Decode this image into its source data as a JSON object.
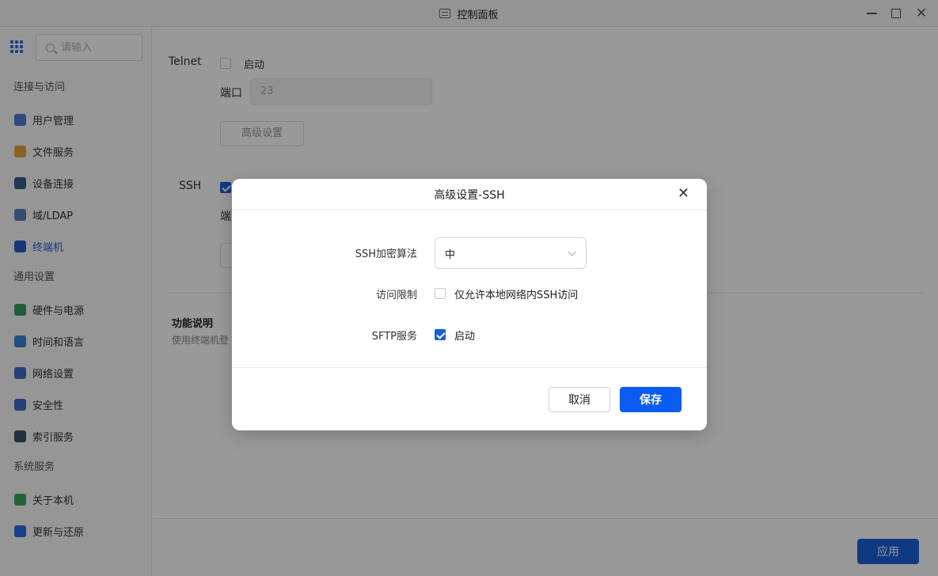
{
  "window": {
    "title": "控制面板",
    "icon": "settings-sliders-icon"
  },
  "sidebar": {
    "search_placeholder": "请输入",
    "groups": [
      {
        "label": "连接与访问",
        "items": [
          {
            "label": "用户管理",
            "icon": "user-icon",
            "color": "#4a7bd6"
          },
          {
            "label": "文件服务",
            "icon": "folder-icon",
            "color": "#e9a23b"
          },
          {
            "label": "设备连接",
            "icon": "device-icon",
            "color": "#3d5a8a"
          },
          {
            "label": "域/LDAP",
            "icon": "domain-icon",
            "color": "#5b7fb8"
          },
          {
            "label": "终端机",
            "icon": "terminal-icon",
            "color": "#2a5cc6",
            "active": true
          }
        ]
      },
      {
        "label": "通用设置",
        "items": [
          {
            "label": "硬件与电源",
            "icon": "hardware-icon",
            "color": "#3a9a5b"
          },
          {
            "label": "时间和语言",
            "icon": "globe-icon",
            "color": "#3b7fd6"
          },
          {
            "label": "网络设置",
            "icon": "network-icon",
            "color": "#3b6fc6"
          },
          {
            "label": "安全性",
            "icon": "shield-icon",
            "color": "#3b6fc6"
          },
          {
            "label": "索引服务",
            "icon": "index-icon",
            "color": "#3d4f6a"
          }
        ]
      },
      {
        "label": "系统服务",
        "items": [
          {
            "label": "关于本机",
            "icon": "info-icon",
            "color": "#3aa55a"
          },
          {
            "label": "更新与还原",
            "icon": "refresh-icon",
            "color": "#2a6ae8"
          }
        ]
      }
    ]
  },
  "main": {
    "telnet": {
      "label": "Telnet",
      "enable_label": "启动",
      "enabled": false,
      "port_label": "端口",
      "port_value": "23",
      "advanced_label": "高级设置"
    },
    "ssh": {
      "label": "SSH",
      "enabled": true,
      "port_label_partial": "端"
    },
    "function": {
      "title": "功能说明",
      "desc_partial": "使用终端机登"
    },
    "apply_label": "应用"
  },
  "dialog": {
    "title": "高级设置-SSH",
    "cipher_label": "SSH加密算法",
    "cipher_value": "中",
    "access_label": "访问限制",
    "access_option": "仅允许本地网络内SSH访问",
    "access_checked": false,
    "sftp_label": "SFTP服务",
    "sftp_option": "启动",
    "sftp_checked": true,
    "cancel_label": "取消",
    "save_label": "保存"
  },
  "colors": {
    "accent": "#1a5fd8",
    "save_button": "#0a5cf0"
  }
}
